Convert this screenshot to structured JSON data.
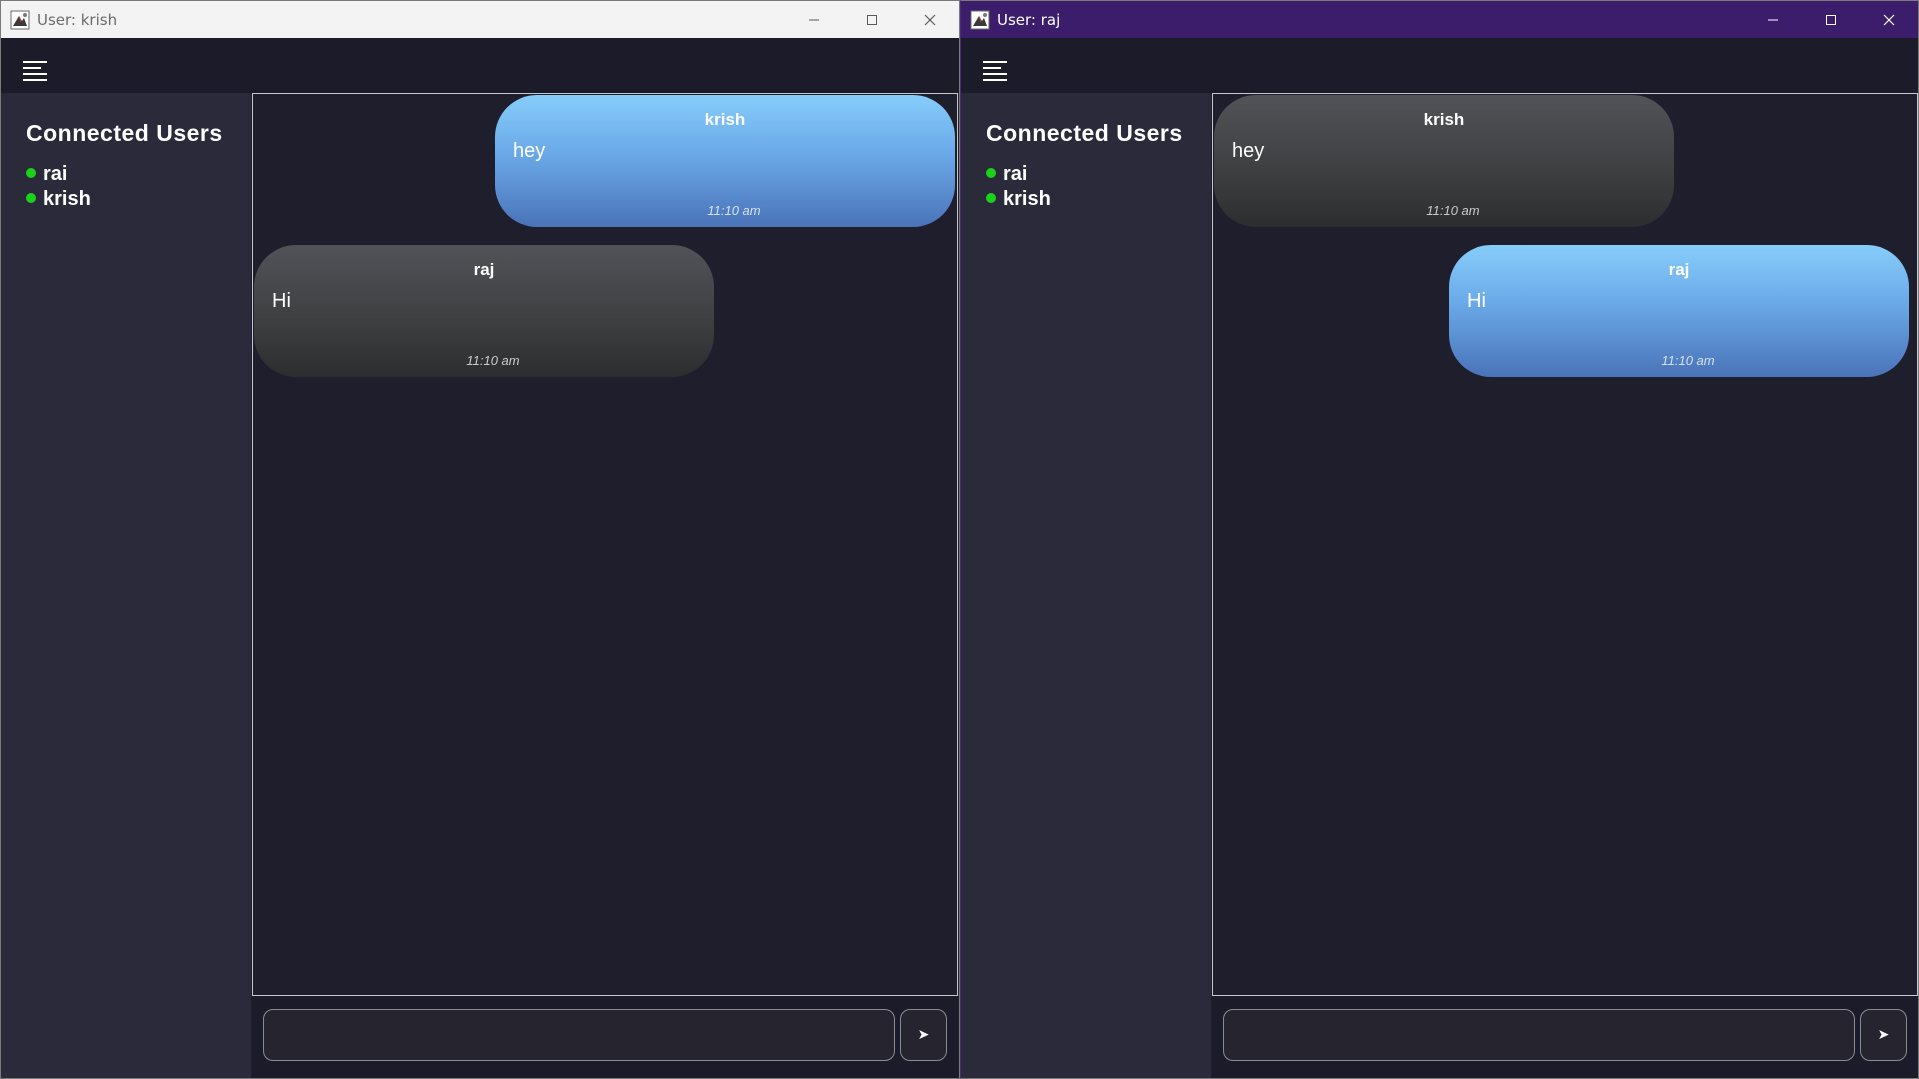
{
  "windows": [
    {
      "title": "User: krish",
      "sidebar": {
        "title": "Connected Users",
        "users": [
          "rai",
          "krish"
        ]
      },
      "messages": [
        {
          "sender": "krish",
          "text": "hey",
          "time": "11:10 am",
          "own": true
        },
        {
          "sender": "raj",
          "text": "Hi",
          "time": "11:10 am",
          "own": false
        }
      ],
      "input": {
        "value": "",
        "send_label": "➤"
      }
    },
    {
      "title": "User: raj",
      "sidebar": {
        "title": "Connected Users",
        "users": [
          "rai",
          "krish"
        ]
      },
      "messages": [
        {
          "sender": "krish",
          "text": "hey",
          "time": "11:10 am",
          "own": false
        },
        {
          "sender": "raj",
          "text": "Hi",
          "time": "11:10 am",
          "own": true
        }
      ],
      "input": {
        "value": "",
        "send_label": "➤"
      }
    }
  ],
  "colors": {
    "online": "#1bd21b",
    "own_bubble_top": "#86cdfa",
    "own_bubble_bottom": "#4a73b8",
    "other_bubble_top": "#515358",
    "other_bubble_bottom": "#2c2d2f",
    "background": "#1f1e2d",
    "sidebar": "#2b2a3b"
  }
}
